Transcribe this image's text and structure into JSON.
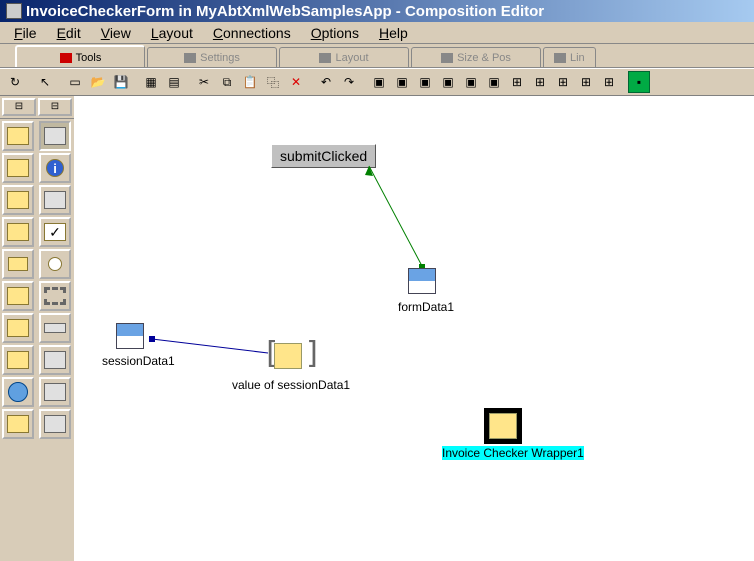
{
  "title": "InvoiceCheckerForm in MyAbtXmlWebSamplesApp - Composition Editor",
  "menu": [
    "File",
    "Edit",
    "View",
    "Layout",
    "Connections",
    "Options",
    "Help"
  ],
  "tabs": [
    {
      "label": "Tools",
      "active": true
    },
    {
      "label": "Settings",
      "active": false
    },
    {
      "label": "Layout",
      "active": false
    },
    {
      "label": "Size & Pos",
      "active": false
    },
    {
      "label": "Lin",
      "active": false
    }
  ],
  "nodes": {
    "submitClicked": {
      "label": "submitClicked"
    },
    "formData": {
      "label": "formData1"
    },
    "sessionData": {
      "label": "sessionData1"
    },
    "valueOfSession": {
      "label": "value of sessionData1"
    },
    "invoiceWrapper": {
      "label": "Invoice Checker Wrapper1"
    }
  }
}
